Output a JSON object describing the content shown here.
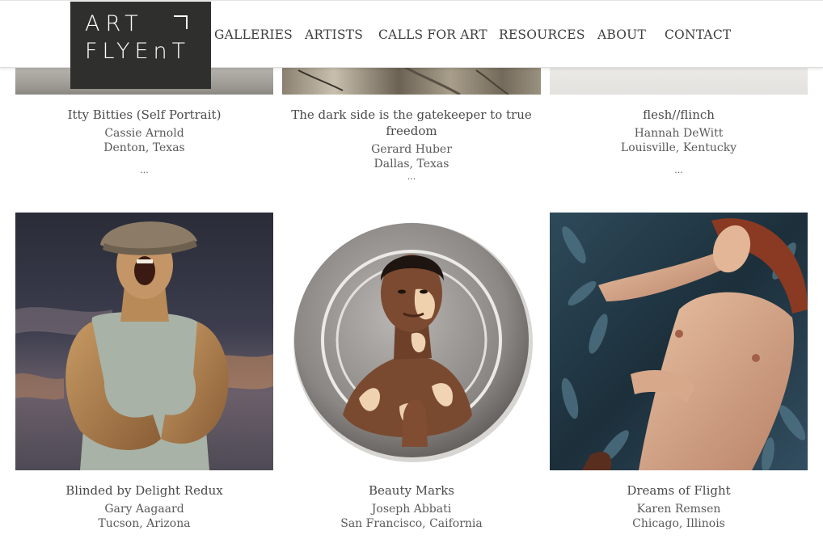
{
  "logo": {
    "line1": "ART",
    "line2": "FLYEnT"
  },
  "nav": [
    "GALLERIES",
    "ARTISTS",
    "CALLS FOR ART",
    "RESOURCES",
    "ABOUT",
    "CONTACT"
  ],
  "row1": [
    {
      "title": "Itty Bitties (Self Portrait)",
      "artist": "Cassie Arnold",
      "location": "Denton, Texas",
      "more": "..."
    },
    {
      "title": "The dark side is the gatekeeper to true freedom",
      "artist": "Gerard Huber",
      "location": "Dallas, Texas",
      "more": "..."
    },
    {
      "title": "flesh//flinch",
      "artist": "Hannah DeWitt",
      "location": "Louisville, Kentucky",
      "more": "..."
    }
  ],
  "row2": [
    {
      "title": "Blinded by Delight Redux",
      "artist": "Gary Aagaard",
      "location": "Tucson, Arizona"
    },
    {
      "title": "Beauty Marks",
      "artist": "Joseph Abbati",
      "location": "San Francisco, Caifornia"
    },
    {
      "title": "Dreams of Flight",
      "artist": "Karen Remsen",
      "location": "Chicago, Illinois"
    }
  ]
}
